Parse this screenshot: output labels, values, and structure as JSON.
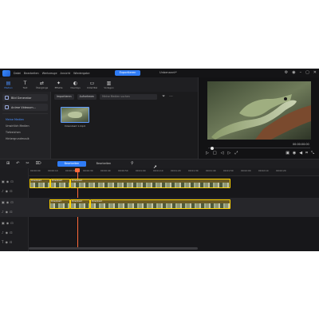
{
  "app": {
    "menu": [
      "Datei",
      "Bearbeiten",
      "Werkzeuge",
      "Ansicht",
      "Wiedergabe"
    ],
    "export_label": "Exportieren",
    "title": "Unbenannt*"
  },
  "toolbar": {
    "items": [
      {
        "label": "Medien",
        "icon": "▤"
      },
      {
        "label": "Text",
        "icon": "T"
      },
      {
        "label": "Übergänge",
        "icon": "⇄"
      },
      {
        "label": "Effekte",
        "icon": "✦"
      },
      {
        "label": "Overlays",
        "icon": "◐"
      },
      {
        "label": "Untertitel",
        "icon": "▭"
      },
      {
        "label": "Vorlagen",
        "icon": "▥"
      }
    ]
  },
  "left_panel": {
    "generator_btn": "Bild Generator",
    "video_btn": "Anime Videoum...",
    "nav": [
      "Meine Medien",
      "Unwirtlich Medien",
      "Tiefzeichen",
      "Hintergrundmusik"
    ]
  },
  "media": {
    "import_label": "Importieren",
    "record_label": "Aufnehmen",
    "search_placeholder": "Meine Medien suchen",
    "thumb_label": "Download 1.mp4"
  },
  "preview": {
    "time": "00:00:00:00"
  },
  "edit": {
    "tab_edit": "Bearbeiten",
    "tab_fx": "Bearbeiten"
  },
  "timeline": {
    "ticks": [
      "00:00:00",
      "00:00:10",
      "00:00:20",
      "00:00:30",
      "00:00:40",
      "00:00:50",
      "00:01:00",
      "00:01:10",
      "00:01:20",
      "00:01:30",
      "00:01:40",
      "00:01:50",
      "00:02:00",
      "00:02:10",
      "00:02:20"
    ],
    "clips_row1": [
      "Download",
      "Download",
      "Download"
    ],
    "clips_row2": [
      "Download",
      "Download",
      "Download"
    ]
  }
}
